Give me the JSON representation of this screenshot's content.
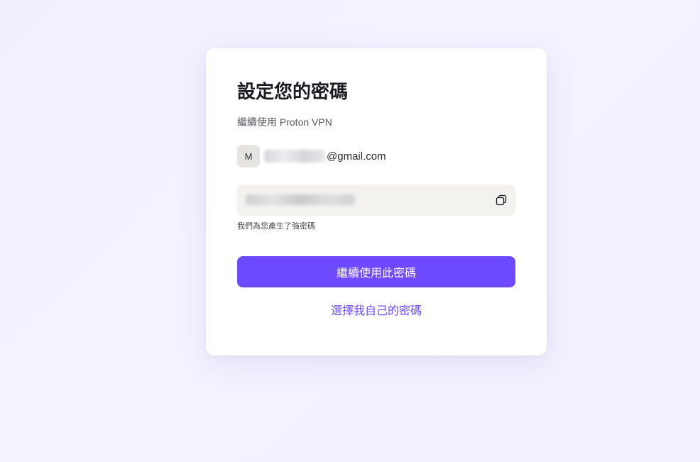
{
  "card": {
    "title": "設定您的密碼",
    "subtitle": "繼續使用 Proton VPN"
  },
  "account": {
    "avatar_initial": "M",
    "email_domain": "@gmail.com"
  },
  "password": {
    "hint": "我們為您產生了強密碼",
    "copy_icon": "copy-icon"
  },
  "actions": {
    "primary_label": "繼續使用此密碼",
    "secondary_label": "選擇我自己的密碼"
  },
  "colors": {
    "accent": "#6d4aff",
    "field_bg": "#f3f2ef",
    "avatar_bg": "#e5e4e1"
  }
}
